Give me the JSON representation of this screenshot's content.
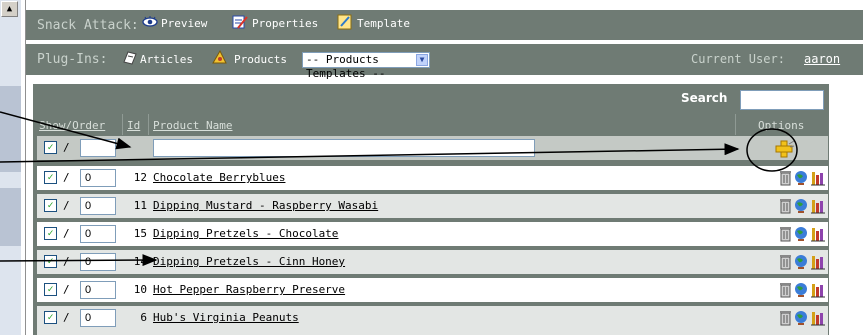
{
  "toolbar1": {
    "app_title": "Snack Attack:",
    "preview_label": "Preview",
    "properties_label": "Properties",
    "template_label": "Template"
  },
  "toolbar2": {
    "plugins_label": "Plug-Ins:",
    "articles_label": "Articles",
    "products_label": "Products",
    "templates_select_value": "-- Products Templates --",
    "current_user_label": "Current User:",
    "current_user_name": "aaron"
  },
  "table": {
    "search_label": "Search",
    "search_value": "",
    "headers": {
      "show_order": "Show/Order",
      "id": "Id",
      "product_name": "Product Name",
      "options": "Options"
    },
    "new_row": {
      "checked": true,
      "separator": "/",
      "order_value": "",
      "name_value": ""
    },
    "rows": [
      {
        "checked": true,
        "separator": "/",
        "order": "0",
        "id": "12",
        "name": "Chocolate Berryblues"
      },
      {
        "checked": true,
        "separator": "/",
        "order": "0",
        "id": "11",
        "name": "Dipping Mustard - Raspberry Wasabi"
      },
      {
        "checked": true,
        "separator": "/",
        "order": "0",
        "id": "15",
        "name": "Dipping Pretzels - Chocolate"
      },
      {
        "checked": true,
        "separator": "/",
        "order": "0",
        "id": "14",
        "name": "Dipping Pretzels - Cinn Honey"
      },
      {
        "checked": true,
        "separator": "/",
        "order": "0",
        "id": "10",
        "name": "Hot Pepper Raspberry Preserve"
      },
      {
        "checked": true,
        "separator": "/",
        "order": "0",
        "id": "6",
        "name": "Hub's Virginia Peanuts"
      }
    ],
    "row_option_icons": [
      "trash-icon",
      "globe-icon",
      "chart-icon"
    ],
    "new_row_option_icon": "add-plus-icon"
  },
  "colors": {
    "toolbar_bg": "#6f7b74",
    "row_alt_bg": "#e3e6e4",
    "selection_strip": "#b9c3d3"
  }
}
